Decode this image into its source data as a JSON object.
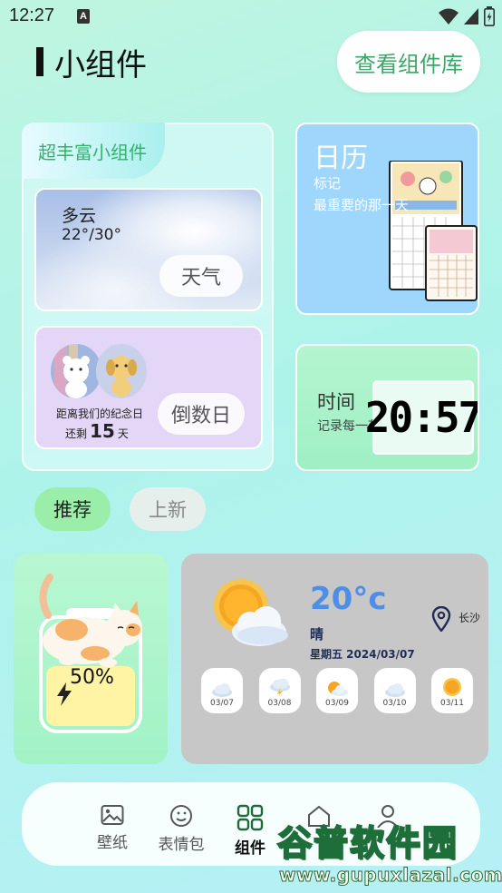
{
  "status": {
    "time": "12:27",
    "notification_badge": "A"
  },
  "header": {
    "title": "小组件",
    "library_button": "查看组件库"
  },
  "featured": {
    "tag": "超丰富小组件",
    "weather": {
      "condition": "多云",
      "temp_range": "22°/30°",
      "button": "天气"
    },
    "countdown": {
      "line1": "距离我们的纪念日",
      "prefix": "还剩",
      "days": "15",
      "unit": "天",
      "button": "倒数日"
    }
  },
  "calendar": {
    "title": "日历",
    "line1": "标记",
    "line2": "最重要的那一天"
  },
  "clock": {
    "title": "时间",
    "subtitle": "记录每一刻",
    "display": "20:57"
  },
  "filters": [
    {
      "label": "推荐",
      "active": true
    },
    {
      "label": "上新",
      "active": false
    }
  ],
  "battery": {
    "percent_label": "50%",
    "level": 0.5
  },
  "weather_widget": {
    "temperature": "20°c",
    "condition": "晴",
    "date_line": "星期五 2024/03/07",
    "city": "长沙",
    "forecast": [
      {
        "date": "03/07",
        "icon": "cloud-icon"
      },
      {
        "date": "03/08",
        "icon": "thunderstorm-icon"
      },
      {
        "date": "03/09",
        "icon": "partly-cloudy-icon"
      },
      {
        "date": "03/10",
        "icon": "cloud-icon"
      },
      {
        "date": "03/11",
        "icon": "sun-icon"
      }
    ]
  },
  "nav": [
    {
      "label": "壁纸",
      "icon": "image-icon"
    },
    {
      "label": "表情包",
      "icon": "emoji-icon"
    },
    {
      "label": "组件",
      "icon": "grid-icon",
      "active": true
    },
    {
      "label": "",
      "icon": "home-icon"
    },
    {
      "label": "",
      "icon": "user-icon"
    }
  ],
  "watermark": {
    "title": "谷普软件园",
    "url": "www.gupuxlazal.com"
  }
}
